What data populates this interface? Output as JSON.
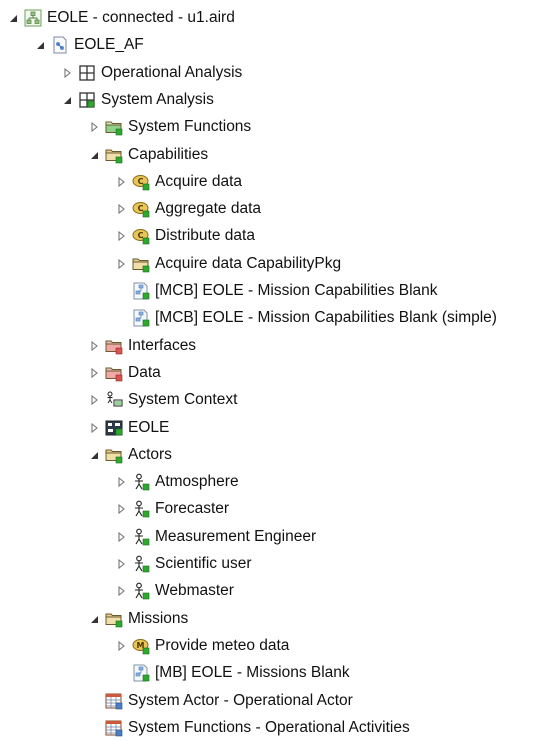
{
  "tree": [
    {
      "label": "EOLE - connected - u1.aird",
      "icon": "project-icon",
      "depth": 0,
      "toggle": "expanded"
    },
    {
      "label": "EOLE_AF",
      "icon": "model-icon",
      "depth": 1,
      "toggle": "expanded"
    },
    {
      "label": "Operational Analysis",
      "icon": "operational-analysis-icon",
      "depth": 2,
      "toggle": "collapsed"
    },
    {
      "label": "System Analysis",
      "icon": "system-analysis-icon",
      "depth": 2,
      "toggle": "expanded"
    },
    {
      "label": "System Functions",
      "icon": "function-package-icon",
      "depth": 3,
      "toggle": "collapsed"
    },
    {
      "label": "Capabilities",
      "icon": "capability-package-icon",
      "depth": 3,
      "toggle": "expanded"
    },
    {
      "label": "Acquire data",
      "icon": "capability-icon",
      "depth": 4,
      "toggle": "collapsed"
    },
    {
      "label": "Aggregate data",
      "icon": "capability-icon",
      "depth": 4,
      "toggle": "collapsed"
    },
    {
      "label": "Distribute data",
      "icon": "capability-icon",
      "depth": 4,
      "toggle": "collapsed"
    },
    {
      "label": "Acquire data CapabilityPkg",
      "icon": "capability-package-icon",
      "depth": 4,
      "toggle": "collapsed"
    },
    {
      "label": "[MCB] EOLE - Mission Capabilities Blank",
      "icon": "diagram-icon",
      "depth": 4,
      "toggle": "none"
    },
    {
      "label": "[MCB] EOLE - Mission Capabilities Blank (simple)",
      "icon": "diagram-icon",
      "depth": 4,
      "toggle": "none"
    },
    {
      "label": "Interfaces",
      "icon": "interface-package-icon",
      "depth": 3,
      "toggle": "collapsed"
    },
    {
      "label": "Data",
      "icon": "data-package-icon",
      "depth": 3,
      "toggle": "collapsed"
    },
    {
      "label": "System Context",
      "icon": "system-context-icon",
      "depth": 3,
      "toggle": "collapsed"
    },
    {
      "label": "EOLE",
      "icon": "system-icon",
      "depth": 3,
      "toggle": "collapsed"
    },
    {
      "label": "Actors",
      "icon": "actor-package-icon",
      "depth": 3,
      "toggle": "expanded"
    },
    {
      "label": "Atmosphere",
      "icon": "actor-icon",
      "depth": 4,
      "toggle": "collapsed"
    },
    {
      "label": "Forecaster",
      "icon": "actor-icon",
      "depth": 4,
      "toggle": "collapsed"
    },
    {
      "label": "Measurement Engineer",
      "icon": "actor-icon",
      "depth": 4,
      "toggle": "collapsed"
    },
    {
      "label": "Scientific user",
      "icon": "actor-icon",
      "depth": 4,
      "toggle": "collapsed"
    },
    {
      "label": "Webmaster",
      "icon": "actor-icon",
      "depth": 4,
      "toggle": "collapsed"
    },
    {
      "label": "Missions",
      "icon": "mission-package-icon",
      "depth": 3,
      "toggle": "expanded"
    },
    {
      "label": "Provide meteo data",
      "icon": "mission-icon",
      "depth": 4,
      "toggle": "collapsed"
    },
    {
      "label": "[MB] EOLE - Missions Blank",
      "icon": "diagram-icon",
      "depth": 4,
      "toggle": "none"
    },
    {
      "label": "System Actor - Operational Actor",
      "icon": "traceability-table-icon",
      "depth": 3,
      "toggle": "none"
    },
    {
      "label": "System Functions - Operational Activities",
      "icon": "traceability-table-icon",
      "depth": 3,
      "toggle": "none"
    }
  ],
  "colors": {
    "accent_green": "#2ea82e",
    "package_red": "#d9534f",
    "folder_tan": "#e9d59a",
    "capability_gold": "#c9a227",
    "diagram_blue": "#4a7fc1",
    "toggle_gray": "#777777"
  }
}
